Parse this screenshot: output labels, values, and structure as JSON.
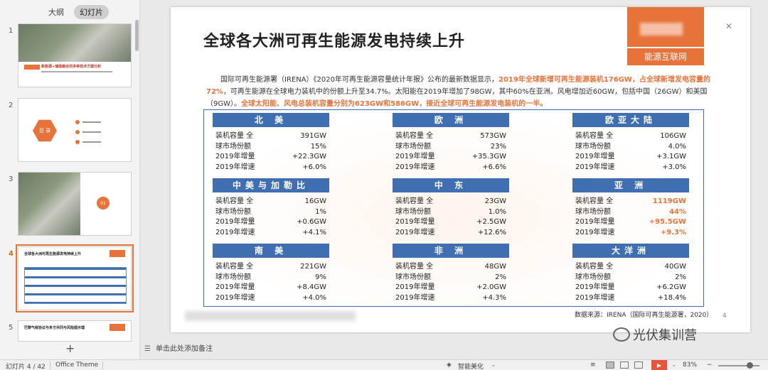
{
  "left_pane": {
    "tabs": [
      {
        "label": "大纲",
        "active": false
      },
      {
        "label": "幻灯片",
        "active": true
      }
    ],
    "thumbnails": [
      {
        "num": "1",
        "title": "新能源+储能融合的多种技术方案分析"
      },
      {
        "num": "2",
        "title": "目 录"
      },
      {
        "num": "3",
        "badge": "01"
      },
      {
        "num": "4",
        "title": "全球各大洲可再生能源发电持续上升",
        "active": true
      },
      {
        "num": "5",
        "title": "巴黎气候协议与多方共同与风险提示理"
      }
    ],
    "add_label": "+"
  },
  "slide": {
    "title": "全球各大洲可再生能源发电持续上升",
    "brand": "能源互联网",
    "intro": {
      "p1": "国际可再生能源署（IRENA）《2020年可再生能源容量统计年报》公布的最新数据显示，",
      "h1": "2019年全球新增可再生能源装机176GW，占全球新增发电容量的72%",
      "p2": "，可再生能源在全球电力装机中的份额上升至34.7%。太阳能在2019年增加了98GW，其中60%在亚洲。风电增加近60GW，包括中国（26GW）和美国（9GW）。",
      "h2": "全球太阳能、风电总装机容量分别为623GW和586GW，接近全球可再生能源发电装机的一半。"
    },
    "row_labels": [
      "装机容量 全",
      "球市场份额",
      "2019年增量",
      "2019年增速"
    ],
    "regions": [
      {
        "name": "北 美",
        "values": [
          "391GW",
          "15%",
          "+22.3GW",
          "+6.0%"
        ]
      },
      {
        "name": "欧 洲",
        "values": [
          "573GW",
          "23%",
          "+35.3GW",
          "+6.6%"
        ]
      },
      {
        "name": "欧亚大陆",
        "values": [
          "106GW",
          "4.0%",
          "+3.1GW",
          "+3.0%"
        ]
      },
      {
        "name": "中美与加勒比",
        "values": [
          "16GW",
          "1%",
          "+0.6GW",
          "+4.1%"
        ]
      },
      {
        "name": "中 东",
        "values": [
          "23GW",
          "1.0%",
          "+2.5GW",
          "+12.6%"
        ]
      },
      {
        "name": "亚 洲",
        "values": [
          "1119GW",
          "44%",
          "+95.5GW",
          "+9.3%"
        ],
        "highlight": true
      },
      {
        "name": "南 美",
        "values": [
          "221GW",
          "9%",
          "+8.4GW",
          "+4.0%"
        ]
      },
      {
        "name": "非 洲",
        "values": [
          "48GW",
          "2%",
          "+2.0GW",
          "+4.3%"
        ]
      },
      {
        "name": "大洋洲",
        "values": [
          "40GW",
          "2%",
          "+6.2GW",
          "+18.4%"
        ]
      }
    ],
    "source": "数据来源：IRENA（国际可再生能源署，2020）",
    "page_number": "4"
  },
  "notes_placeholder": "单击此处添加备注",
  "watermark": "光伏集训营",
  "statusbar": {
    "slide_counter": "幻灯片 4 / 42",
    "theme": "Office Theme",
    "beautify": "智能美化",
    "zoom": "83%"
  },
  "colors": {
    "accent": "#e8733a",
    "table_header": "#3f6fb0"
  }
}
